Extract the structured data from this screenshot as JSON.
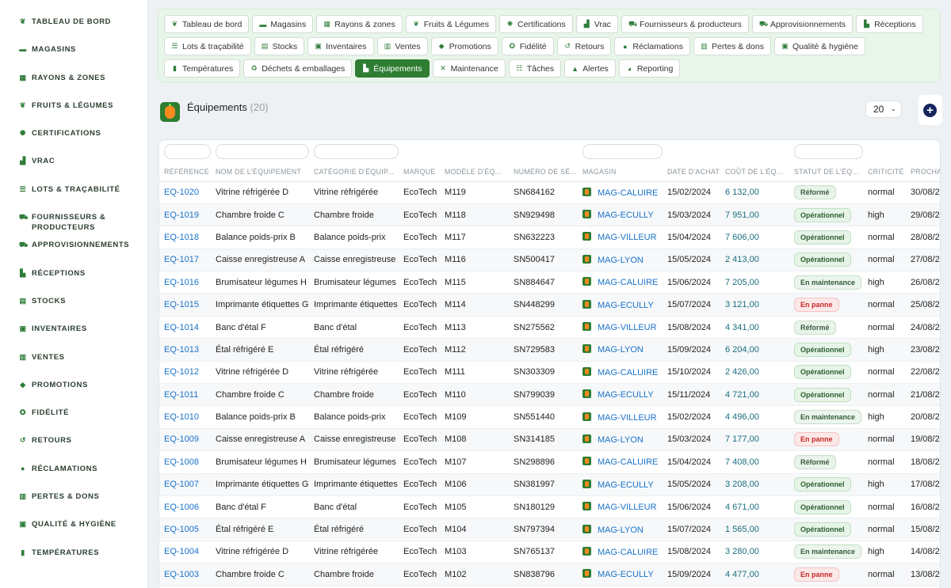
{
  "sidebar": {
    "items": [
      {
        "label": "TABLEAU DE BORD",
        "icon": "leaf-icon"
      },
      {
        "label": "MAGASINS",
        "icon": "store-icon"
      },
      {
        "label": "RAYONS & ZONES",
        "icon": "grid-icon"
      },
      {
        "label": "FRUITS & LÉGUMES",
        "icon": "leaf-icon"
      },
      {
        "label": "CERTIFICATIONS",
        "icon": "badge-icon"
      },
      {
        "label": "VRAC",
        "icon": "bulk-icon"
      },
      {
        "label": "LOTS & TRAÇABILITÉ",
        "icon": "list-icon"
      },
      {
        "label": "FOURNISSEURS & PRODUCTEURS",
        "icon": "tractor-icon"
      },
      {
        "label": "APPROVISIONNEMENTS",
        "icon": "truck-icon"
      },
      {
        "label": "RÉCEPTIONS",
        "icon": "receive-icon"
      },
      {
        "label": "STOCKS",
        "icon": "warehouse-icon"
      },
      {
        "label": "INVENTAIRES",
        "icon": "clipboard-icon"
      },
      {
        "label": "VENTES",
        "icon": "cart-icon"
      },
      {
        "label": "PROMOTIONS",
        "icon": "tag-icon"
      },
      {
        "label": "FIDÉLITÉ",
        "icon": "award-icon"
      },
      {
        "label": "RETOURS",
        "icon": "undo-icon"
      },
      {
        "label": "RÉCLAMATIONS",
        "icon": "comment-icon"
      },
      {
        "label": "PERTES & DONS",
        "icon": "trash-icon"
      },
      {
        "label": "QUALITÉ & HYGIÈNE",
        "icon": "clipboard-check-icon"
      },
      {
        "label": "TEMPÉRATURES",
        "icon": "thermometer-icon"
      }
    ]
  },
  "tabs": [
    {
      "label": "Tableau de bord",
      "icon": "leaf-icon"
    },
    {
      "label": "Magasins",
      "icon": "store-icon"
    },
    {
      "label": "Rayons & zones",
      "icon": "grid-icon"
    },
    {
      "label": "Fruits & Légumes",
      "icon": "leaf-icon"
    },
    {
      "label": "Certifications",
      "icon": "badge-icon"
    },
    {
      "label": "Vrac",
      "icon": "bulk-icon"
    },
    {
      "label": "Fournisseurs & producteurs",
      "icon": "tractor-icon"
    },
    {
      "label": "Approvisionnements",
      "icon": "truck-icon"
    },
    {
      "label": "Réceptions",
      "icon": "receive-icon"
    },
    {
      "label": "Lots & traçabilité",
      "icon": "list-icon"
    },
    {
      "label": "Stocks",
      "icon": "warehouse-icon"
    },
    {
      "label": "Inventaires",
      "icon": "clipboard-icon"
    },
    {
      "label": "Ventes",
      "icon": "cart-icon"
    },
    {
      "label": "Promotions",
      "icon": "tag-icon"
    },
    {
      "label": "Fidélité",
      "icon": "award-icon"
    },
    {
      "label": "Retours",
      "icon": "undo-icon"
    },
    {
      "label": "Réclamations",
      "icon": "comment-icon"
    },
    {
      "label": "Pertes & dons",
      "icon": "trash-icon"
    },
    {
      "label": "Qualité & hygiène",
      "icon": "clipboard-check-icon"
    },
    {
      "label": "Températures",
      "icon": "thermometer-icon"
    },
    {
      "label": "Déchets & emballages",
      "icon": "recycle-icon"
    },
    {
      "label": "Équipements",
      "icon": "equipment-icon",
      "active": true
    },
    {
      "label": "Maintenance",
      "icon": "tools-icon"
    },
    {
      "label": "Tâches",
      "icon": "tasks-icon"
    },
    {
      "label": "Alertes",
      "icon": "bell-icon"
    },
    {
      "label": "Reporting",
      "icon": "chart-pie-icon"
    }
  ],
  "header": {
    "title": "Équipements",
    "count": "(20)",
    "per_page": "20",
    "colors": {
      "accent": "#2e7d32",
      "link": "#1a73c8",
      "add_button": "#14245c"
    }
  },
  "table": {
    "columns": [
      {
        "label": "RÉFÉRENCE",
        "filter": true
      },
      {
        "label": "NOM DE L'ÉQUIPEMENT",
        "filter": true
      },
      {
        "label": "CATÉGORIE D'ÉQUIP...",
        "filter": true
      },
      {
        "label": "MARQUE",
        "filter": false
      },
      {
        "label": "MODÈLE D'ÉQ...",
        "filter": false
      },
      {
        "label": "NUMÉRO DE SÉ...",
        "filter": false
      },
      {
        "label": "MAGASIN",
        "filter": true
      },
      {
        "label": "DATE D'ACHAT",
        "filter": false
      },
      {
        "label": "COÛT DE L'ÉQ...",
        "filter": false
      },
      {
        "label": "STATUT DE L'ÉQ...",
        "filter": true
      },
      {
        "label": "CRITICITÉ",
        "filter": false
      },
      {
        "label": "PROCHA",
        "filter": false
      }
    ],
    "rows": [
      {
        "ref": "EQ-1020",
        "name": "Vitrine réfrigérée D",
        "category": "Vitrine réfrigérée",
        "brand": "EcoTech",
        "model": "M119",
        "serial": "SN684162",
        "store": "MAG-CALUIRE",
        "date": "15/02/2024",
        "cost": "6 132,00",
        "status": "Réformé",
        "criticality": "normal",
        "next": "30/08/20"
      },
      {
        "ref": "EQ-1019",
        "name": "Chambre froide C",
        "category": "Chambre froide",
        "brand": "EcoTech",
        "model": "M118",
        "serial": "SN929498",
        "store": "MAG-ECULLY",
        "date": "15/03/2024",
        "cost": "7 951,00",
        "status": "Opérationnel",
        "criticality": "high",
        "next": "29/08/20"
      },
      {
        "ref": "EQ-1018",
        "name": "Balance poids-prix B",
        "category": "Balance poids-prix",
        "brand": "EcoTech",
        "model": "M117",
        "serial": "SN632223",
        "store": "MAG-VILLEUR",
        "date": "15/04/2024",
        "cost": "7 606,00",
        "status": "Opérationnel",
        "criticality": "normal",
        "next": "28/08/20"
      },
      {
        "ref": "EQ-1017",
        "name": "Caisse enregistreuse A",
        "category": "Caisse enregistreuse",
        "brand": "EcoTech",
        "model": "M116",
        "serial": "SN500417",
        "store": "MAG-LYON",
        "date": "15/05/2024",
        "cost": "2 413,00",
        "status": "Opérationnel",
        "criticality": "normal",
        "next": "27/08/20"
      },
      {
        "ref": "EQ-1016",
        "name": "Brumisateur légumes H",
        "category": "Brumisateur légumes",
        "brand": "EcoTech",
        "model": "M115",
        "serial": "SN884647",
        "store": "MAG-CALUIRE",
        "date": "15/06/2024",
        "cost": "7 205,00",
        "status": "En maintenance",
        "criticality": "high",
        "next": "26/08/20"
      },
      {
        "ref": "EQ-1015",
        "name": "Imprimante étiquettes G",
        "category": "Imprimante étiquettes",
        "brand": "EcoTech",
        "model": "M114",
        "serial": "SN448299",
        "store": "MAG-ECULLY",
        "date": "15/07/2024",
        "cost": "3 121,00",
        "status": "En panne",
        "criticality": "normal",
        "next": "25/08/20"
      },
      {
        "ref": "EQ-1014",
        "name": "Banc d'étal F",
        "category": "Banc d'étal",
        "brand": "EcoTech",
        "model": "M113",
        "serial": "SN275562",
        "store": "MAG-VILLEUR",
        "date": "15/08/2024",
        "cost": "4 341,00",
        "status": "Réformé",
        "criticality": "normal",
        "next": "24/08/20"
      },
      {
        "ref": "EQ-1013",
        "name": "Étal réfrigéré E",
        "category": "Étal réfrigéré",
        "brand": "EcoTech",
        "model": "M112",
        "serial": "SN729583",
        "store": "MAG-LYON",
        "date": "15/09/2024",
        "cost": "6 204,00",
        "status": "Opérationnel",
        "criticality": "high",
        "next": "23/08/20"
      },
      {
        "ref": "EQ-1012",
        "name": "Vitrine réfrigérée D",
        "category": "Vitrine réfrigérée",
        "brand": "EcoTech",
        "model": "M111",
        "serial": "SN303309",
        "store": "MAG-CALUIRE",
        "date": "15/10/2024",
        "cost": "2 426,00",
        "status": "Opérationnel",
        "criticality": "normal",
        "next": "22/08/20"
      },
      {
        "ref": "EQ-1011",
        "name": "Chambre froide C",
        "category": "Chambre froide",
        "brand": "EcoTech",
        "model": "M110",
        "serial": "SN799039",
        "store": "MAG-ECULLY",
        "date": "15/11/2024",
        "cost": "4 721,00",
        "status": "Opérationnel",
        "criticality": "normal",
        "next": "21/08/20"
      },
      {
        "ref": "EQ-1010",
        "name": "Balance poids-prix B",
        "category": "Balance poids-prix",
        "brand": "EcoTech",
        "model": "M109",
        "serial": "SN551440",
        "store": "MAG-VILLEUR",
        "date": "15/02/2024",
        "cost": "4 496,00",
        "status": "En maintenance",
        "criticality": "high",
        "next": "20/08/20"
      },
      {
        "ref": "EQ-1009",
        "name": "Caisse enregistreuse A",
        "category": "Caisse enregistreuse",
        "brand": "EcoTech",
        "model": "M108",
        "serial": "SN314185",
        "store": "MAG-LYON",
        "date": "15/03/2024",
        "cost": "7 177,00",
        "status": "En panne",
        "criticality": "normal",
        "next": "19/08/20"
      },
      {
        "ref": "EQ-1008",
        "name": "Brumisateur légumes H",
        "category": "Brumisateur légumes",
        "brand": "EcoTech",
        "model": "M107",
        "serial": "SN298896",
        "store": "MAG-CALUIRE",
        "date": "15/04/2024",
        "cost": "7 408,00",
        "status": "Réformé",
        "criticality": "normal",
        "next": "18/08/20"
      },
      {
        "ref": "EQ-1007",
        "name": "Imprimante étiquettes G",
        "category": "Imprimante étiquettes",
        "brand": "EcoTech",
        "model": "M106",
        "serial": "SN381997",
        "store": "MAG-ECULLY",
        "date": "15/05/2024",
        "cost": "3 208,00",
        "status": "Opérationnel",
        "criticality": "high",
        "next": "17/08/20"
      },
      {
        "ref": "EQ-1006",
        "name": "Banc d'étal F",
        "category": "Banc d'étal",
        "brand": "EcoTech",
        "model": "M105",
        "serial": "SN180129",
        "store": "MAG-VILLEUR",
        "date": "15/06/2024",
        "cost": "4 671,00",
        "status": "Opérationnel",
        "criticality": "normal",
        "next": "16/08/20"
      },
      {
        "ref": "EQ-1005",
        "name": "Étal réfrigéré E",
        "category": "Étal réfrigéré",
        "brand": "EcoTech",
        "model": "M104",
        "serial": "SN797394",
        "store": "MAG-LYON",
        "date": "15/07/2024",
        "cost": "1 565,00",
        "status": "Opérationnel",
        "criticality": "normal",
        "next": "15/08/20"
      },
      {
        "ref": "EQ-1004",
        "name": "Vitrine réfrigérée D",
        "category": "Vitrine réfrigérée",
        "brand": "EcoTech",
        "model": "M103",
        "serial": "SN765137",
        "store": "MAG-CALUIRE",
        "date": "15/08/2024",
        "cost": "3 280,00",
        "status": "En maintenance",
        "criticality": "high",
        "next": "14/08/20"
      },
      {
        "ref": "EQ-1003",
        "name": "Chambre froide C",
        "category": "Chambre froide",
        "brand": "EcoTech",
        "model": "M102",
        "serial": "SN838796",
        "store": "MAG-ECULLY",
        "date": "15/09/2024",
        "cost": "4 477,00",
        "status": "En panne",
        "criticality": "normal",
        "next": "13/08/20"
      }
    ]
  }
}
